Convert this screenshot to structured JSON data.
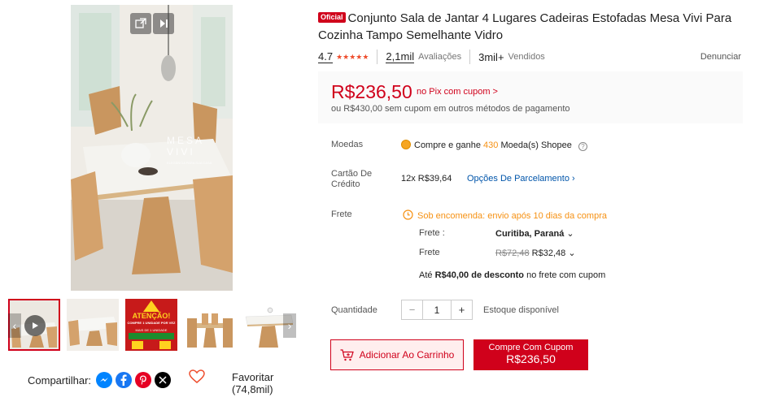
{
  "gallery": {
    "main_image_alt": "Mesa Vivi dining set",
    "watermark_line1": "MESA",
    "watermark_line2": "VIVI",
    "watermark_tagline": "ELEGÂNCIA PARA SUA CASA",
    "thumb3_text1": "ATENÇÃO!",
    "thumb3_text2": "COMPRE 1 UNIDADE POR VEZ",
    "thumb3_text3": "MAIS DE 1 UNIDADE"
  },
  "share": {
    "label": "Compartilhar:",
    "icons": [
      "messenger-icon",
      "facebook-icon",
      "pinterest-icon",
      "x-icon"
    ]
  },
  "favorite": {
    "label": "Favoritar",
    "count": "(74,8mil)"
  },
  "product": {
    "badge": "Oficial",
    "title": "Conjunto Sala de Jantar 4 Lugares Cadeiras Estofadas Mesa Vivi Para Cozinha Tampo Semelhante Vidro",
    "rating": "4.7",
    "reviews_count": "2,1mil",
    "reviews_label": "Avaliações",
    "sold_count": "3mil+",
    "sold_label": "Vendidos",
    "report": "Denunciar"
  },
  "price": {
    "pix_price": "R$236,50",
    "pix_label": "no Pix com cupom >",
    "alt_text": "ou R$430,00 sem cupom em outros métodos de pagamento"
  },
  "coins": {
    "label": "Moedas",
    "text_before": "Compre e ganhe",
    "amount": "430",
    "text_after": "Moeda(s) Shopee"
  },
  "card": {
    "label_line1": "Cartão De",
    "label_line2": "Crédito",
    "installments": "12x R$39,64",
    "options_link": "Opções De Parcelamento"
  },
  "shipping": {
    "label": "Frete",
    "notice": "Sob encomenda: envio após 10 dias da compra",
    "to_label": "Frete :",
    "to_value": "Curitiba, Paraná",
    "cost_label": "Frete",
    "old_cost": "R$72,48",
    "new_cost": "R$32,48",
    "discount_prefix": "Até",
    "discount_value": "R$40,00 de desconto",
    "discount_suffix": "no frete com cupom"
  },
  "quantity": {
    "label": "Quantidade",
    "minus": "−",
    "value": "1",
    "plus": "+",
    "stock": "Estoque disponível"
  },
  "actions": {
    "add_to_cart": "Adicionar Ao Carrinho",
    "buy_line1": "Compre Com Cupom",
    "buy_line2": "R$236,50"
  },
  "colors": {
    "brand_red": "#d0011b",
    "accent_orange": "#ee4d2d",
    "link_blue": "#0055aa"
  }
}
